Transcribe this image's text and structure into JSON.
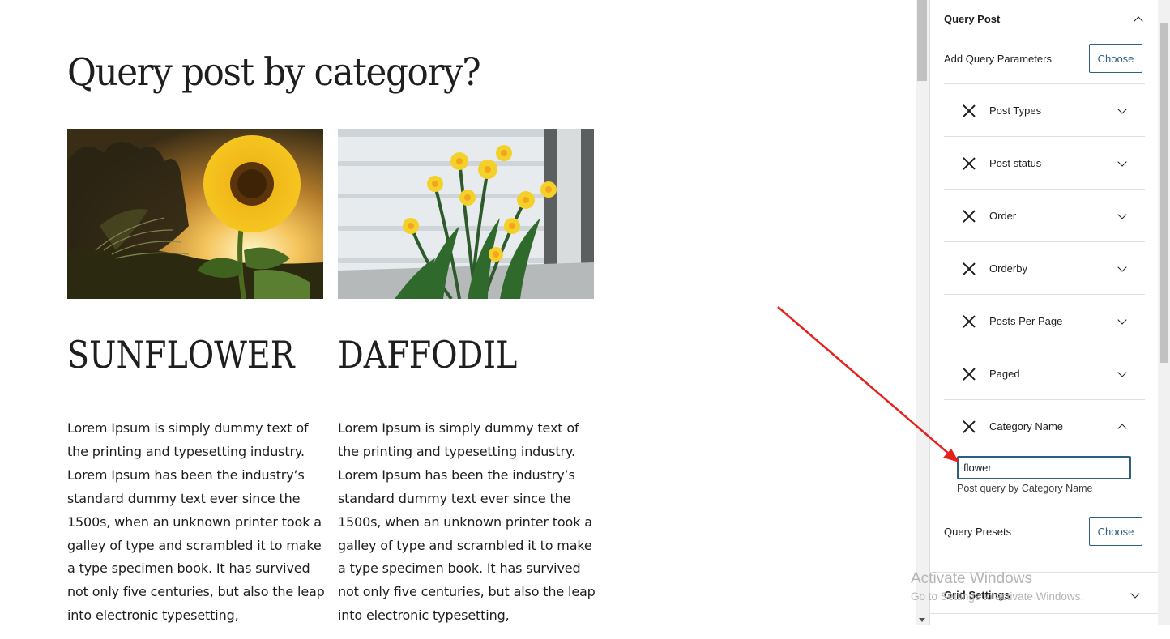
{
  "page": {
    "title": "Query post by category?"
  },
  "posts": [
    {
      "title": "SUNFLOWER",
      "image_alt": "sunflower",
      "excerpt": "Lorem Ipsum is simply dummy text of the printing and typesetting industry. Lorem Ipsum has been the industry’s standard dummy text ever since the 1500s, when an unknown printer took a galley of type and scrambled it to make a type specimen book. It has survived not only five centuries, but also the leap into electronic typesetting,"
    },
    {
      "title": "DAFFODIL",
      "image_alt": "daffodil",
      "excerpt": "Lorem Ipsum is simply dummy text of the printing and typesetting industry. Lorem Ipsum has been the industry’s standard dummy text ever since the 1500s, when an unknown printer took a galley of type and scrambled it to make a type specimen book. It has survived not only five centuries, but also the leap into electronic typesetting,"
    }
  ],
  "sidebar": {
    "panel_title": "Query Post",
    "add_params_label": "Add Query Parameters",
    "choose_label": "Choose",
    "params": [
      {
        "label": "Post Types",
        "expanded": false
      },
      {
        "label": "Post status",
        "expanded": false
      },
      {
        "label": "Order",
        "expanded": false
      },
      {
        "label": "Orderby",
        "expanded": false
      },
      {
        "label": "Posts Per Page",
        "expanded": false
      },
      {
        "label": "Paged",
        "expanded": false
      },
      {
        "label": "Category Name",
        "expanded": true
      }
    ],
    "category_input_value": "flower",
    "category_help": "Post query by Category Name",
    "presets_label": "Query Presets",
    "presets_choose_label": "Choose",
    "grid_settings_title": "Grid Settings"
  },
  "watermark": {
    "line1": "Activate Windows",
    "line2": "Go to Settings to activate Windows."
  },
  "colors": {
    "accent": "#2d5f80",
    "annotation_arrow": "#e8201a"
  }
}
